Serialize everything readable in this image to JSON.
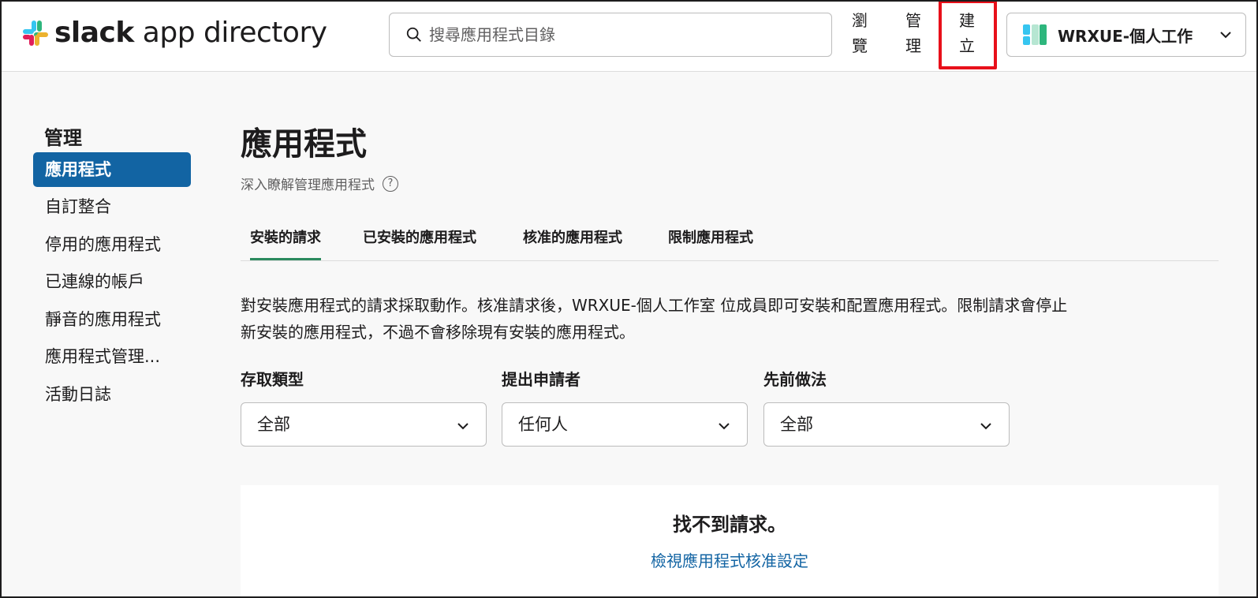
{
  "header": {
    "logo_bold": "slack",
    "logo_rest": " app directory",
    "search_placeholder": "搜尋應用程式目錄",
    "nav": {
      "browse_1": "瀏",
      "browse_2": "覽",
      "manage_1": "管",
      "manage_2": "理",
      "create_1": "建",
      "create_2": "立"
    },
    "workspace_name": "WRXUE-個人工作",
    "highlight_color": "#e8101a"
  },
  "sidebar": {
    "title": "管理",
    "items": [
      {
        "label": "應用程式",
        "active": true
      },
      {
        "label": "自訂整合"
      },
      {
        "label": "停用的應用程式"
      },
      {
        "label": "已連線的帳戶"
      },
      {
        "label": "靜音的應用程式"
      },
      {
        "label": "應用程式管理..."
      },
      {
        "label": "活動日誌"
      }
    ],
    "active_color": "#1264a3"
  },
  "main": {
    "title": "應用程式",
    "learn_more": "深入瞭解管理應用程式",
    "tabs": [
      {
        "label": "安裝的請求",
        "active": true
      },
      {
        "label": "已安裝的應用程式"
      },
      {
        "label": "核准的應用程式"
      },
      {
        "label": "限制應用程式"
      }
    ],
    "description_line1": "對安裝應用程式的請求採取動作。核准請求後，WRXUE-個人工作室 位成員即可安裝和配置應用程式。限制請求會停止",
    "description_line2": "新安裝的應用程式，不過不會移除現有安裝的應用程式。",
    "filters": [
      {
        "label": "存取類型",
        "value": "全部"
      },
      {
        "label": "提出申請者",
        "value": "任何人"
      },
      {
        "label": "先前做法",
        "value": "全部"
      }
    ],
    "empty_title": "找不到請求。",
    "empty_link": "檢視應用程式核准設定"
  }
}
